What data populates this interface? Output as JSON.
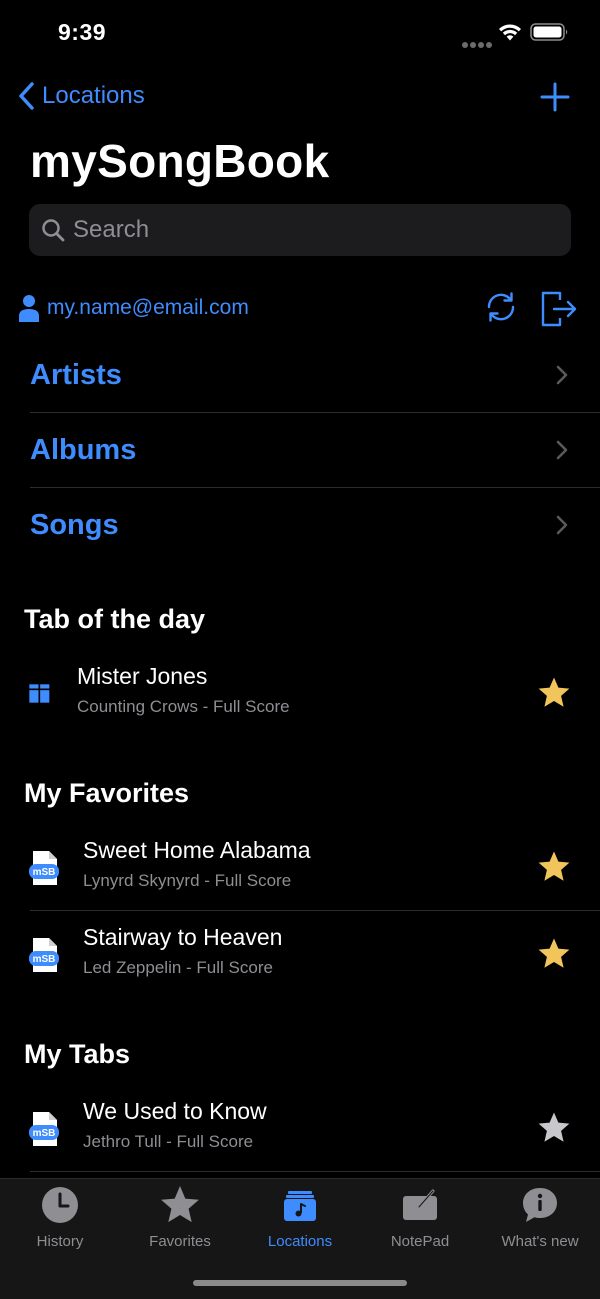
{
  "status_bar": {
    "time": "9:39"
  },
  "nav": {
    "back_label": "Locations"
  },
  "page_title": "mySongBook",
  "search": {
    "placeholder": "Search"
  },
  "account": {
    "email": "my.name@email.com"
  },
  "browse": [
    {
      "label": "Artists"
    },
    {
      "label": "Albums"
    },
    {
      "label": "Songs"
    }
  ],
  "tab_of_the_day": {
    "title": "Tab of the day",
    "item": {
      "title": "Mister Jones",
      "subtitle": "Counting Crows - Full Score",
      "favorite": true
    }
  },
  "favorites": {
    "title": "My Favorites",
    "items": [
      {
        "title": "Sweet Home Alabama",
        "subtitle": "Lynyrd Skynyrd - Full Score",
        "favorite": true
      },
      {
        "title": "Stairway to Heaven",
        "subtitle": "Led Zeppelin - Full Score",
        "favorite": true
      }
    ]
  },
  "my_tabs": {
    "title": "My Tabs",
    "items": [
      {
        "title": "We Used to Know",
        "subtitle": "Jethro Tull - Full Score",
        "favorite": false
      }
    ]
  },
  "tabbar": {
    "items": [
      {
        "label": "History",
        "icon": "clock-icon",
        "active": false
      },
      {
        "label": "Favorites",
        "icon": "star-icon",
        "active": false
      },
      {
        "label": "Locations",
        "icon": "music-folder-icon",
        "active": true
      },
      {
        "label": "NotePad",
        "icon": "notepad-icon",
        "active": false
      },
      {
        "label": "What's new",
        "icon": "info-bubble-icon",
        "active": false
      }
    ]
  },
  "colors": {
    "accent": "#3f8cff",
    "star_gold": "#f2c55c",
    "star_gray": "#c7c7cc",
    "background": "#000000"
  }
}
